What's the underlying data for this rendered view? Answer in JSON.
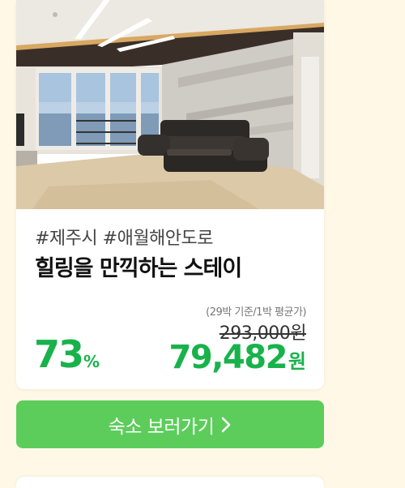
{
  "card": {
    "photo_alt": "living room with sofa and ocean view",
    "tags": "#제주시 #애월해안도로",
    "title": "힐링을 만끽하는 스테이",
    "discount_value": "73",
    "discount_unit": "%",
    "price_basis": "(29박 기준/1박 평균가)",
    "original_price": "293,000원",
    "sale_price": "79,482",
    "sale_unit": "원"
  },
  "cta": {
    "label": "숙소 보러가기",
    "icon": "chevron-right-icon"
  },
  "colors": {
    "background": "#fff8e6",
    "accent_green": "#18b24b",
    "button_green": "#5ccd5b"
  }
}
